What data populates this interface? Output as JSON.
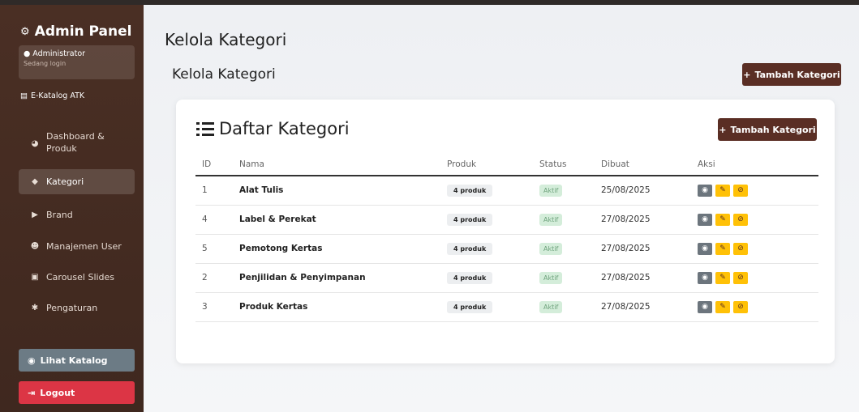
{
  "sidebar": {
    "brand_title": "Admin Panel",
    "user_name": "Administrator",
    "user_status": "Sedang login",
    "catalog_link": "E-Katalog ATK",
    "nav": [
      {
        "label": "Dashboard &",
        "label2": "Produk",
        "icon": "dashboard-icon"
      },
      {
        "label": "Kategori",
        "icon": "layers-icon",
        "active": true
      },
      {
        "label": "Brand",
        "icon": "tag-icon"
      },
      {
        "label": "Manajemen User",
        "icon": "users-icon"
      },
      {
        "label": "Carousel Slides",
        "icon": "image-icon"
      },
      {
        "label": "Pengaturan",
        "icon": "gear-icon"
      }
    ],
    "lihat_katalog": "Lihat Katalog",
    "logout": "Logout"
  },
  "main": {
    "page_title": "Kelola Kategori",
    "sub_title": "Kelola Kategori",
    "add_button": "Tambah Kategori",
    "card": {
      "title": "Daftar Kategori",
      "add_button": "Tambah Kategori",
      "columns": [
        "ID",
        "Nama",
        "Produk",
        "Status",
        "Dibuat",
        "Aksi"
      ],
      "rows": [
        {
          "id": "1",
          "name": "Alat Tulis",
          "produk": "4 produk",
          "status": "Aktif",
          "created": "25/08/2025"
        },
        {
          "id": "4",
          "name": "Label & Perekat",
          "produk": "4 produk",
          "status": "Aktif",
          "created": "27/08/2025"
        },
        {
          "id": "5",
          "name": "Pemotong Kertas",
          "produk": "4 produk",
          "status": "Aktif",
          "created": "27/08/2025"
        },
        {
          "id": "2",
          "name": "Penjilidan & Penyimpanan",
          "produk": "4 produk",
          "status": "Aktif",
          "created": "27/08/2025"
        },
        {
          "id": "3",
          "name": "Produk Kertas",
          "produk": "4 produk",
          "status": "Aktif",
          "created": "27/08/2025"
        }
      ]
    }
  },
  "colors": {
    "sidebar_bg": "#4a2f24",
    "accent": "#5a2e24",
    "warning": "#ffc107",
    "danger": "#dc3545",
    "secondary": "#6c7b85"
  }
}
